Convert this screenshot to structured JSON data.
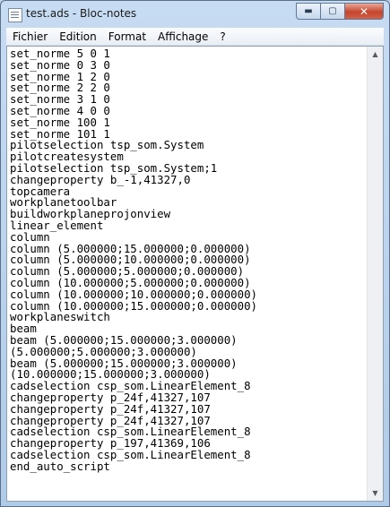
{
  "window": {
    "title": "test.ads - Bloc-notes"
  },
  "caption": {
    "minimize": "▬",
    "maximize": "▢",
    "close": "✕"
  },
  "menu": [
    "Fichier",
    "Edition",
    "Format",
    "Affichage",
    "?"
  ],
  "scrollbar": {
    "up": "▲",
    "down": "▼"
  },
  "lines": [
    "set_norme 5 0 1",
    "set_norme 0 3 0",
    "set_norme 1 2 0",
    "set_norme 2 2 0",
    "set_norme 3 1 0",
    "set_norme 4 0 0",
    "set_norme 100 1",
    "set_norme 101 1",
    "pilotselection tsp_som.System",
    "pilotcreatesystem",
    "pilotselection tsp_som.System;1",
    "changeproperty b_-1,41327,0",
    "topcamera",
    "workplanetoolbar",
    "buildworkplaneprojonview",
    "linear_element",
    "column",
    "column (5.000000;15.000000;0.000000)",
    "column (5.000000;10.000000;0.000000)",
    "column (5.000000;5.000000;0.000000)",
    "column (10.000000;5.000000;0.000000)",
    "column (10.000000;10.000000;0.000000)",
    "column (10.000000;15.000000;0.000000)",
    "workplaneswitch",
    "beam",
    "beam (5.000000;15.000000;3.000000)",
    "(5.000000;5.000000;3.000000)",
    "beam (5.000000;15.000000;3.000000)",
    "(10.000000;15.000000;3.000000)",
    "cadselection csp_som.LinearElement_8",
    "changeproperty p_24f,41327,107",
    "changeproperty p_24f,41327,107",
    "changeproperty p_24f,41327,107",
    "cadselection csp_som.LinearElement_8",
    "changeproperty p_197,41369,106",
    "cadselection csp_som.LinearElement_8",
    "end_auto_script"
  ]
}
